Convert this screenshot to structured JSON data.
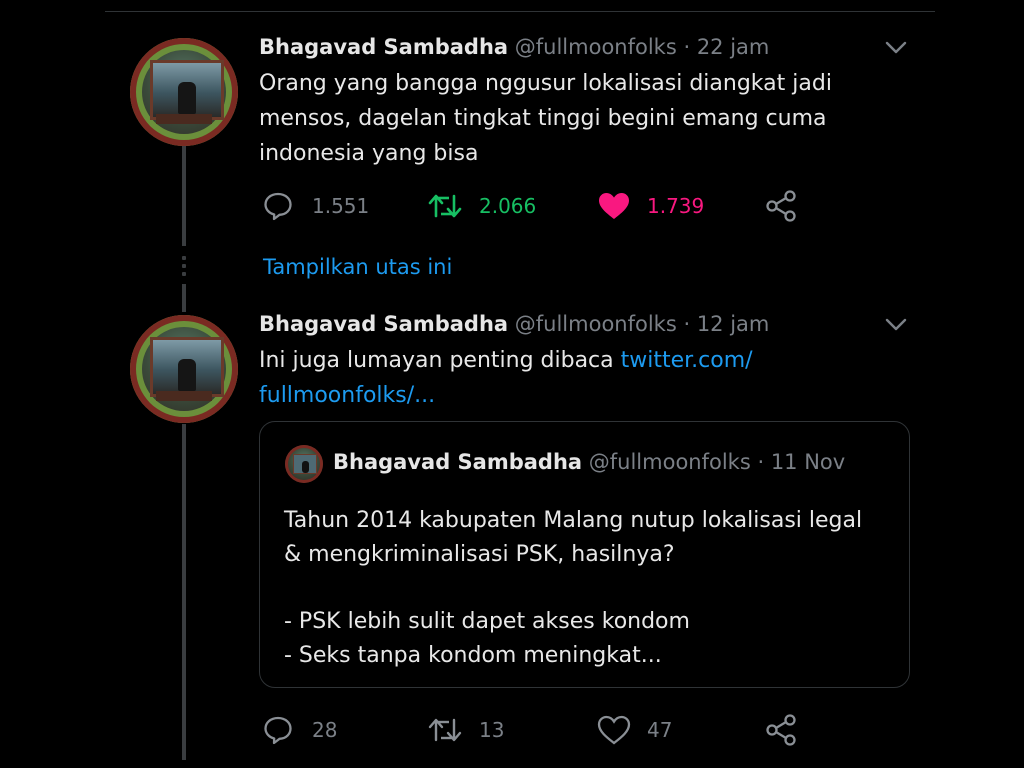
{
  "tweets": [
    {
      "author_name": "Bhagavad Sambadha",
      "author_handle": "@fullmoonfolks",
      "time": "· 22 jam",
      "text_lines": [
        "Orang yang bangga nggusur lokalisasi diangkat jadi",
        "mensos, dagelan tingkat tinggi begini emang cuma",
        "indonesia yang bisa"
      ],
      "replies": "1.551",
      "retweets": "2.066",
      "likes": "1.739",
      "liked": true,
      "retweeted": true
    },
    {
      "author_name": "Bhagavad Sambadha",
      "author_handle": "@fullmoonfolks",
      "time": "· 12 jam",
      "text": "Ini juga lumayan penting dibaca",
      "link_line1": "twitter.com/",
      "link_line2": "fullmoonfolks/...",
      "replies": "28",
      "retweets": "13",
      "likes": "47",
      "liked": false,
      "retweeted": false
    }
  ],
  "show_thread": "Tampilkan utas ini",
  "quoted": {
    "author_name": "Bhagavad Sambadha",
    "author_handle": "@fullmoonfolks",
    "time": "· 11 Nov",
    "lines": [
      "Tahun 2014 kabupaten Malang nutup lokalisasi legal",
      "& mengkriminalisasi PSK, hasilnya?",
      "",
      "- PSK lebih sulit dapet akses kondom",
      "- Seks tanpa kondom meningkat..."
    ]
  },
  "colors": {
    "background": "#000000",
    "link": "#1d9bf0",
    "retweet_active": "#17bf63",
    "like_active": "#f91880",
    "muted": "#7b8087"
  },
  "icons": [
    "chevron-down-icon",
    "reply-icon",
    "retweet-icon",
    "heart-icon",
    "share-icon"
  ]
}
